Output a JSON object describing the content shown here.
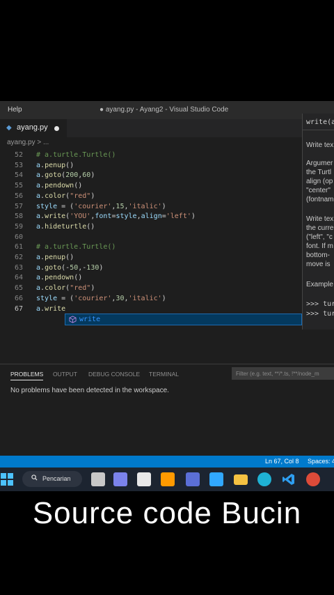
{
  "titlebar": {
    "menu": "Help",
    "title": "● ayang.py - Ayang2 - Visual Studio Code"
  },
  "tab": {
    "filename": "ayang.py",
    "lang_icon": "python-icon"
  },
  "breadcrumb": "ayang.py > ...",
  "editor": {
    "lines": [
      {
        "n": "52",
        "tokens": [
          {
            "c": "t-comment",
            "t": "# a.turtle.Turtle()"
          }
        ]
      },
      {
        "n": "53",
        "tokens": [
          {
            "c": "t-var",
            "t": "a"
          },
          {
            "c": "t-op",
            "t": "."
          },
          {
            "c": "t-fn",
            "t": "penup"
          },
          {
            "c": "t-op",
            "t": "()"
          }
        ]
      },
      {
        "n": "54",
        "tokens": [
          {
            "c": "t-var",
            "t": "a"
          },
          {
            "c": "t-op",
            "t": "."
          },
          {
            "c": "t-fn",
            "t": "goto"
          },
          {
            "c": "t-op",
            "t": "("
          },
          {
            "c": "t-num",
            "t": "200"
          },
          {
            "c": "t-op",
            "t": ","
          },
          {
            "c": "t-num",
            "t": "60"
          },
          {
            "c": "t-op",
            "t": ")"
          }
        ]
      },
      {
        "n": "55",
        "tokens": [
          {
            "c": "t-var",
            "t": "a"
          },
          {
            "c": "t-op",
            "t": "."
          },
          {
            "c": "t-fn",
            "t": "pendown"
          },
          {
            "c": "t-op",
            "t": "()"
          }
        ]
      },
      {
        "n": "56",
        "tokens": [
          {
            "c": "t-var",
            "t": "a"
          },
          {
            "c": "t-op",
            "t": "."
          },
          {
            "c": "t-fn",
            "t": "color"
          },
          {
            "c": "t-op",
            "t": "("
          },
          {
            "c": "t-str",
            "t": "\"red\""
          },
          {
            "c": "t-op",
            "t": ")"
          }
        ]
      },
      {
        "n": "57",
        "tokens": [
          {
            "c": "t-var",
            "t": "style"
          },
          {
            "c": "t-op",
            "t": " = ("
          },
          {
            "c": "t-str",
            "t": "'courier'"
          },
          {
            "c": "t-op",
            "t": ","
          },
          {
            "c": "t-num",
            "t": "15"
          },
          {
            "c": "t-op",
            "t": ","
          },
          {
            "c": "t-str",
            "t": "'italic'"
          },
          {
            "c": "t-op",
            "t": ")"
          }
        ]
      },
      {
        "n": "58",
        "tokens": [
          {
            "c": "t-var",
            "t": "a"
          },
          {
            "c": "t-op",
            "t": "."
          },
          {
            "c": "t-fn",
            "t": "write"
          },
          {
            "c": "t-op",
            "t": "("
          },
          {
            "c": "t-str",
            "t": "'YOU'"
          },
          {
            "c": "t-op",
            "t": ","
          },
          {
            "c": "t-var",
            "t": "font"
          },
          {
            "c": "t-op",
            "t": "="
          },
          {
            "c": "t-var",
            "t": "style"
          },
          {
            "c": "t-op",
            "t": ","
          },
          {
            "c": "t-var",
            "t": "align"
          },
          {
            "c": "t-op",
            "t": "="
          },
          {
            "c": "t-str",
            "t": "'left'"
          },
          {
            "c": "t-op",
            "t": ")"
          }
        ]
      },
      {
        "n": "59",
        "tokens": [
          {
            "c": "t-var",
            "t": "a"
          },
          {
            "c": "t-op",
            "t": "."
          },
          {
            "c": "t-fn",
            "t": "hideturtle"
          },
          {
            "c": "t-op",
            "t": "()"
          }
        ]
      },
      {
        "n": "60",
        "tokens": []
      },
      {
        "n": "61",
        "tokens": [
          {
            "c": "t-comment",
            "t": "# a.turtle.Turtle()"
          }
        ]
      },
      {
        "n": "62",
        "tokens": [
          {
            "c": "t-var",
            "t": "a"
          },
          {
            "c": "t-op",
            "t": "."
          },
          {
            "c": "t-fn",
            "t": "penup"
          },
          {
            "c": "t-op",
            "t": "()"
          }
        ]
      },
      {
        "n": "63",
        "tokens": [
          {
            "c": "t-var",
            "t": "a"
          },
          {
            "c": "t-op",
            "t": "."
          },
          {
            "c": "t-fn",
            "t": "goto"
          },
          {
            "c": "t-op",
            "t": "(-"
          },
          {
            "c": "t-num",
            "t": "50"
          },
          {
            "c": "t-op",
            "t": ",-"
          },
          {
            "c": "t-num",
            "t": "130"
          },
          {
            "c": "t-op",
            "t": ")"
          }
        ]
      },
      {
        "n": "64",
        "tokens": [
          {
            "c": "t-var",
            "t": "a"
          },
          {
            "c": "t-op",
            "t": "."
          },
          {
            "c": "t-fn",
            "t": "pendown"
          },
          {
            "c": "t-op",
            "t": "()"
          }
        ]
      },
      {
        "n": "65",
        "tokens": [
          {
            "c": "t-var",
            "t": "a"
          },
          {
            "c": "t-op",
            "t": "."
          },
          {
            "c": "t-fn",
            "t": "color"
          },
          {
            "c": "t-op",
            "t": "("
          },
          {
            "c": "t-str",
            "t": "\"red\""
          },
          {
            "c": "t-op",
            "t": ")"
          }
        ]
      },
      {
        "n": "66",
        "tokens": [
          {
            "c": "t-var",
            "t": "style"
          },
          {
            "c": "t-op",
            "t": " = ("
          },
          {
            "c": "t-str",
            "t": "'courier'"
          },
          {
            "c": "t-op",
            "t": ","
          },
          {
            "c": "t-num",
            "t": "30"
          },
          {
            "c": "t-op",
            "t": ","
          },
          {
            "c": "t-str",
            "t": "'italic'"
          },
          {
            "c": "t-op",
            "t": ")"
          }
        ]
      },
      {
        "n": "67",
        "tokens": [
          {
            "c": "t-var",
            "t": "a"
          },
          {
            "c": "t-op",
            "t": "."
          },
          {
            "c": "t-fn",
            "t": "write"
          }
        ]
      }
    ],
    "current_line": "67"
  },
  "suggestion": {
    "label": "write",
    "icon": "method-cube-icon"
  },
  "hover_doc": {
    "signature": "write(a",
    "paragraphs": [
      "Write tex",
      "Argumer",
      "the Turtl",
      "align (op",
      "\"center\"",
      "(fontnam",
      "Write tex",
      "the curre",
      "(\"left\", \"c",
      "font. If m",
      "bottom-",
      "move is",
      "Example"
    ],
    "examples": [
      ">>> tur",
      ">>> tur"
    ]
  },
  "panel": {
    "tabs": [
      "PROBLEMS",
      "OUTPUT",
      "DEBUG CONSOLE",
      "TERMINAL"
    ],
    "active_tab": "PROBLEMS",
    "filter_placeholder": "Filter (e.g. text, **/*.ts, !**/node_m",
    "message": "No problems have been detected in the workspace."
  },
  "statusbar": {
    "position": "Ln 67, Col 8",
    "spaces": "Spaces: 4"
  },
  "taskbar": {
    "search_label": "Pencarian",
    "apps": [
      {
        "name": "start-icon",
        "color": "#4cc2ff"
      },
      {
        "name": "task-view-icon",
        "color": "#c8c8c8"
      },
      {
        "name": "teams-icon",
        "color": "#7b83eb"
      },
      {
        "name": "store-icon",
        "color": "#e8e8e8"
      },
      {
        "name": "illustrator-icon",
        "color": "#ff9a00"
      },
      {
        "name": "powerpoint-icon",
        "color": "#5b6fd6"
      },
      {
        "name": "photoshop-icon",
        "color": "#31a8ff"
      },
      {
        "name": "file-explorer-icon",
        "color": "#f5c242"
      },
      {
        "name": "edge-icon",
        "color": "#1fb2d4"
      },
      {
        "name": "vscode-icon",
        "color": "#2e9ef0"
      },
      {
        "name": "chrome-icon",
        "color": "#dd4b39"
      }
    ]
  },
  "caption": "Source code Bucin",
  "colors": {
    "statusbar": "#007acc",
    "editor_bg": "#1e1e1e",
    "accent": "#3794ff"
  }
}
